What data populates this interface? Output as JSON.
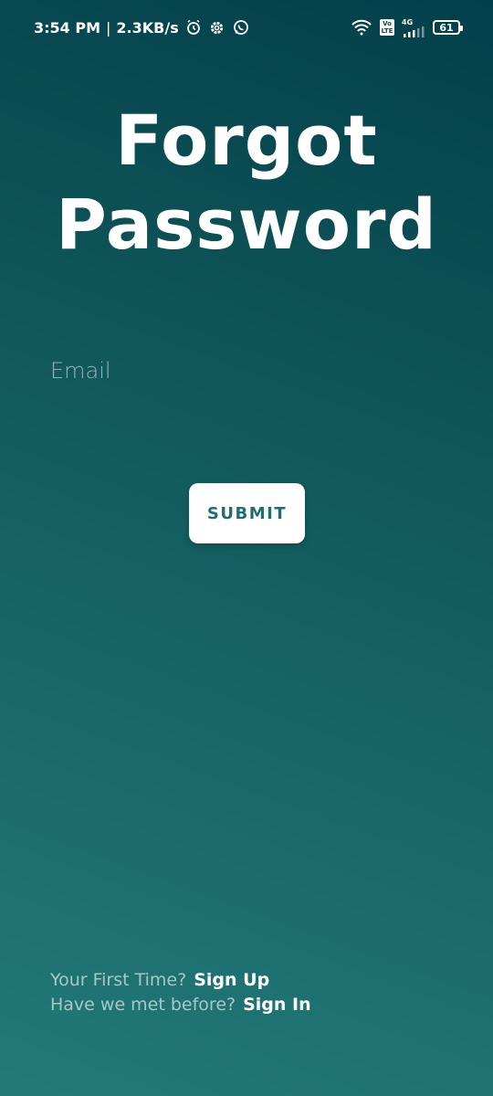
{
  "status_bar": {
    "time": "3:54 PM",
    "separator": "|",
    "speed": "2.3KB/s",
    "network": "4G",
    "battery": "61",
    "volte_top": "Vo",
    "volte_bottom": "LTE"
  },
  "screen": {
    "title_line1": "Forgot",
    "title_line2": "Password"
  },
  "form": {
    "email_placeholder": "Email",
    "submit_label": "SUBMIT"
  },
  "footer": {
    "first_time_text": "Your First Time?",
    "sign_up_label": "Sign Up",
    "met_before_text": "Have we met before?",
    "sign_in_label": "Sign In"
  },
  "colors": {
    "gradient_top": "#033f4a",
    "gradient_bottom": "#227a78",
    "button_text": "#1f6e72"
  }
}
